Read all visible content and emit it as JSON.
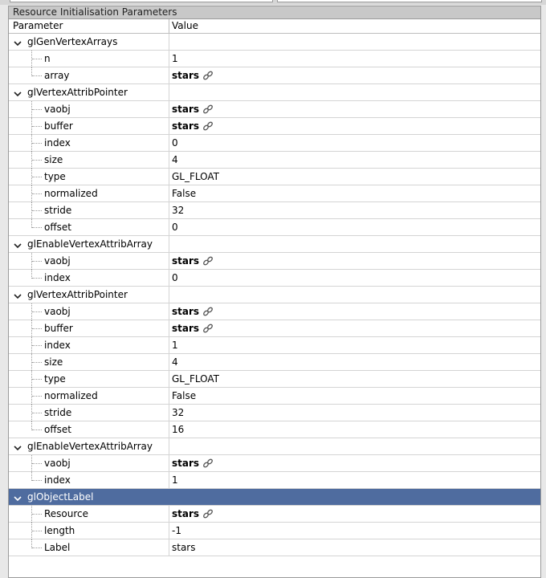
{
  "panel": {
    "title": "Resource Initialisation Parameters",
    "columns": {
      "parameter": "Parameter",
      "value": "Value"
    }
  },
  "groups": [
    {
      "name": "glGenVertexArrays",
      "params": [
        {
          "name": "n",
          "value": "1",
          "link": false
        },
        {
          "name": "array",
          "value": "stars",
          "link": true
        }
      ]
    },
    {
      "name": "glVertexAttribPointer",
      "params": [
        {
          "name": "vaobj",
          "value": "stars",
          "link": true
        },
        {
          "name": "buffer",
          "value": "stars",
          "link": true
        },
        {
          "name": "index",
          "value": "0",
          "link": false
        },
        {
          "name": "size",
          "value": "4",
          "link": false
        },
        {
          "name": "type",
          "value": "GL_FLOAT",
          "link": false
        },
        {
          "name": "normalized",
          "value": "False",
          "link": false
        },
        {
          "name": "stride",
          "value": "32",
          "link": false
        },
        {
          "name": "offset",
          "value": "0",
          "link": false
        }
      ]
    },
    {
      "name": "glEnableVertexAttribArray",
      "params": [
        {
          "name": "vaobj",
          "value": "stars",
          "link": true
        },
        {
          "name": "index",
          "value": "0",
          "link": false
        }
      ]
    },
    {
      "name": "glVertexAttribPointer",
      "params": [
        {
          "name": "vaobj",
          "value": "stars",
          "link": true
        },
        {
          "name": "buffer",
          "value": "stars",
          "link": true
        },
        {
          "name": "index",
          "value": "1",
          "link": false
        },
        {
          "name": "size",
          "value": "4",
          "link": false
        },
        {
          "name": "type",
          "value": "GL_FLOAT",
          "link": false
        },
        {
          "name": "normalized",
          "value": "False",
          "link": false
        },
        {
          "name": "stride",
          "value": "32",
          "link": false
        },
        {
          "name": "offset",
          "value": "16",
          "link": false
        }
      ]
    },
    {
      "name": "glEnableVertexAttribArray",
      "params": [
        {
          "name": "vaobj",
          "value": "stars",
          "link": true
        },
        {
          "name": "index",
          "value": "1",
          "link": false
        }
      ]
    },
    {
      "name": "glObjectLabel",
      "selected": true,
      "params": [
        {
          "name": "Resource",
          "value": "stars",
          "link": true
        },
        {
          "name": "length",
          "value": "-1",
          "link": false
        },
        {
          "name": "Label",
          "value": "stars",
          "link": false
        }
      ]
    }
  ],
  "icons": {
    "expanded": "chevron-down-icon",
    "resource_link": "link-icon"
  },
  "colors": {
    "selection": "#4f6c9f",
    "panel_title_bg": "#c8c8c8"
  }
}
